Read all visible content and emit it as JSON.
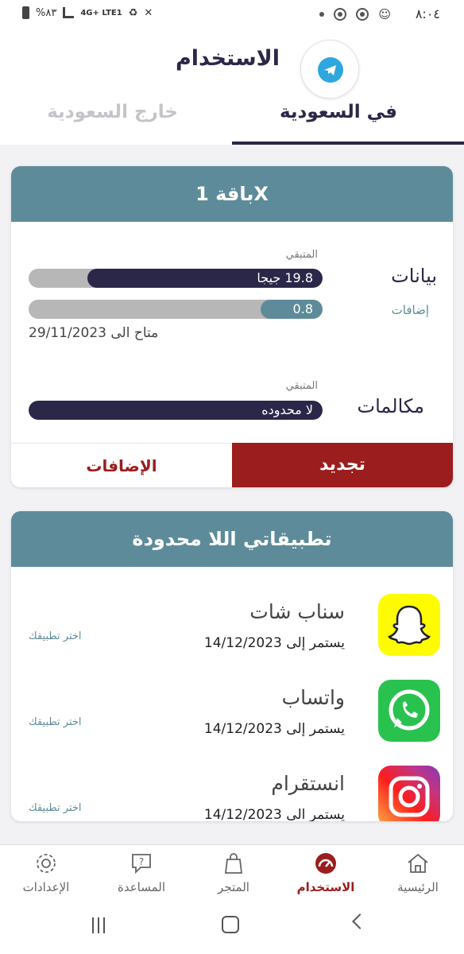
{
  "status_bar": {
    "time": "٨:٠٤",
    "battery": "%٨٣",
    "network": "4G+ LTE1"
  },
  "header": {
    "title": "الاستخدام",
    "logo_icon": "telegram-icon",
    "tabs": [
      {
        "label": "في السعودية",
        "active": true
      },
      {
        "label": "خارج السعودية",
        "active": false
      }
    ]
  },
  "package_card": {
    "title": "باقة 1X",
    "data_row": {
      "label": "بيانات",
      "remaining_caption": "المتبقي",
      "remaining_value": "19.8 جيجا",
      "remaining_fill_fraction": 0.8,
      "addons_label": "إضافات",
      "addons_value": "0.8",
      "addons_fill_fraction": 0.21,
      "available_until": "متاح الى 29/11/2023"
    },
    "calls_row": {
      "label": "مكالمات",
      "remaining_caption": "المتبقي",
      "remaining_value": "لا محدوده",
      "remaining_fill_fraction": 1.0
    },
    "renew_button": "تجديد",
    "addons_button": "الإضافات"
  },
  "apps_card": {
    "title": "تطبيقاتي اللا محدودة",
    "apps": [
      {
        "name": "سناب شات",
        "until": "يستمر إلى 14/12/2023",
        "action": "اختر تطبيقك",
        "icon": "snapchat-icon"
      },
      {
        "name": "واتساب",
        "until": "يستمر إلى 14/12/2023",
        "action": "اختر تطبيقك",
        "icon": "whatsapp-icon"
      },
      {
        "name": "انستقرام",
        "until": "يستمر الى 14/12/2023",
        "action": "اختر تطبيقك",
        "icon": "instagram-icon"
      }
    ]
  },
  "bottom_nav": [
    {
      "label": "الرئيسية",
      "icon": "home-icon",
      "active": false
    },
    {
      "label": "الاستخدام",
      "icon": "gauge-icon",
      "active": true
    },
    {
      "label": "المتجر",
      "icon": "shopping-bag-icon",
      "active": false
    },
    {
      "label": "المساعدة",
      "icon": "help-chat-icon",
      "active": false
    },
    {
      "label": "الإعدادات",
      "icon": "gear-icon",
      "active": false
    }
  ],
  "colors": {
    "primary": "#2b2748",
    "teal": "#5e8b99",
    "accent_red": "#9b1d1d",
    "track_grey": "#b7b7b7"
  }
}
